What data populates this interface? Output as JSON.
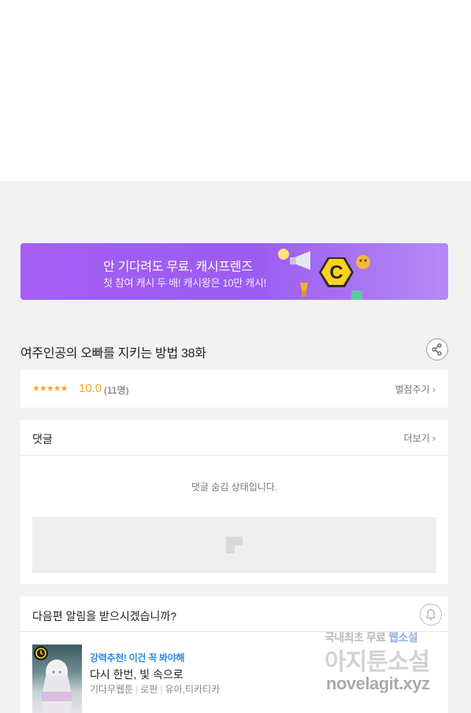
{
  "banner": {
    "title": "안 기다려도 무료, 캐시프렌즈",
    "subtitle": "첫 참여 캐시 두 배! 캐시왕은 10만 캐시!"
  },
  "episode": {
    "title": "여주인공의 오빠를 지키는 방법 38화"
  },
  "rating": {
    "stars": "★★★★★",
    "score": "10.0",
    "count": "(11명)",
    "rate_link": "별점주기 ›"
  },
  "comments": {
    "title": "댓글",
    "more_link": "더보기 ›",
    "hidden_message": "댓글 숨김 상태입니다."
  },
  "notify": {
    "title": "다음편 알림을 받으시겠습니까?"
  },
  "recommendation": {
    "tag": "강력추천! 이건 꼭 봐야해",
    "title": "다시 한번, 빛 속으로",
    "meta": [
      "기다무웹툰",
      "로판",
      "유아,티카티카"
    ]
  },
  "watermark": {
    "line1_prefix": "국내최초 무료 ",
    "line1_highlight": "웹소설",
    "line2": "아지툰소설",
    "line3": "novelagit.xyz"
  },
  "colors": {
    "banner_gradient_start": "#a45ef2",
    "accent_star": "#f5a623",
    "rec_tag": "#2b8be6"
  }
}
